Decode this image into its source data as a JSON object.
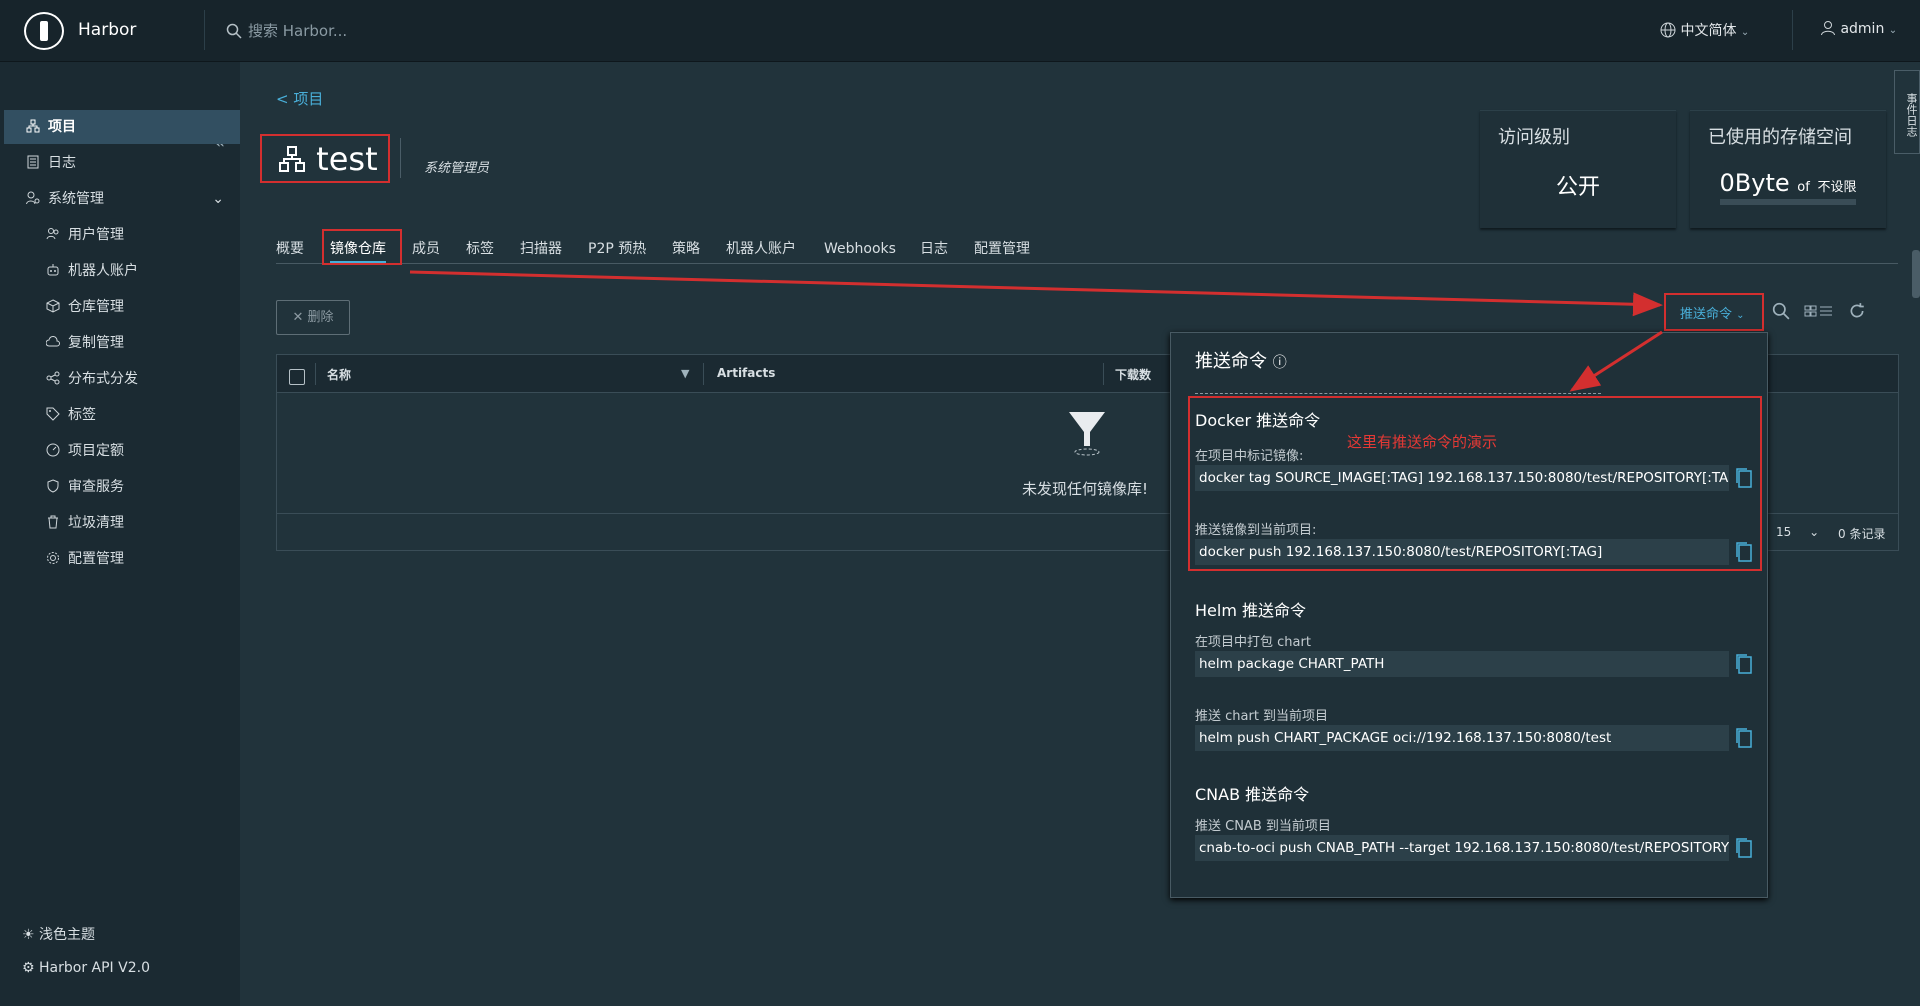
{
  "header": {
    "app_name": "Harbor",
    "search_placeholder": "搜索 Harbor...",
    "language": "中文简体",
    "user": "admin"
  },
  "sidebar": {
    "items": [
      {
        "label": "项目",
        "icon": "project-icon",
        "active": true
      },
      {
        "label": "日志",
        "icon": "log-icon"
      },
      {
        "label": "系统管理",
        "icon": "admin-icon"
      },
      {
        "label": "用户管理",
        "icon": "users-icon"
      },
      {
        "label": "机器人账户",
        "icon": "robot-icon"
      },
      {
        "label": "仓库管理",
        "icon": "box-icon"
      },
      {
        "label": "复制管理",
        "icon": "cloud-icon"
      },
      {
        "label": "分布式分发",
        "icon": "share-icon"
      },
      {
        "label": "标签",
        "icon": "tag-icon"
      },
      {
        "label": "项目定额",
        "icon": "gauge-icon"
      },
      {
        "label": "审查服务",
        "icon": "shield-icon"
      },
      {
        "label": "垃圾清理",
        "icon": "trash-icon"
      },
      {
        "label": "配置管理",
        "icon": "gear-icon"
      }
    ],
    "theme": "浅色主题",
    "api": "Harbor API V2.0"
  },
  "page": {
    "back_link": "项目",
    "project_name": "test",
    "role": "系统管理员"
  },
  "cards": {
    "access_label": "访问级别",
    "access_value": "公开",
    "storage_label": "已使用的存储空间",
    "storage_value": "0Byte",
    "storage_of": "of",
    "storage_limit": "不设限"
  },
  "tabs": [
    "概要",
    "镜像仓库",
    "成员",
    "标签",
    "扫描器",
    "P2P 预热",
    "策略",
    "机器人账户",
    "Webhooks",
    "日志",
    "配置管理"
  ],
  "toolbar": {
    "delete_label": "删除",
    "push_command_label": "推送命令"
  },
  "grid": {
    "columns": [
      "名称",
      "Artifacts",
      "下载数"
    ],
    "empty_text": "未发现任何镜像库!",
    "page_size": "15",
    "total": "0 条记录"
  },
  "popup": {
    "title": "推送命令",
    "note": "这里有推送命令的演示",
    "docker_title": "Docker 推送命令",
    "docker_tag_label": "在项目中标记镜像:",
    "docker_tag_cmd": "docker tag SOURCE_IMAGE[:TAG] 192.168.137.150:8080/test/REPOSITORY[:TA",
    "docker_push_label": "推送镜像到当前项目:",
    "docker_push_cmd": "docker push 192.168.137.150:8080/test/REPOSITORY[:TAG]",
    "helm_title": "Helm 推送命令",
    "helm_package_label": "在项目中打包 chart",
    "helm_package_cmd": "helm package CHART_PATH",
    "helm_push_label": "推送 chart 到当前项目",
    "helm_push_cmd": "helm push CHART_PACKAGE oci://192.168.137.150:8080/test",
    "cnab_title": "CNAB 推送命令",
    "cnab_label": "推送 CNAB 到当前项目",
    "cnab_cmd": "cnab-to-oci push CNAB_PATH --target 192.168.137.150:8080/test/REPOSITORY"
  },
  "side_tab": "事件日志",
  "colors": {
    "accent": "#49afd9",
    "annotation": "#d32f2f",
    "background": "#21333b"
  }
}
